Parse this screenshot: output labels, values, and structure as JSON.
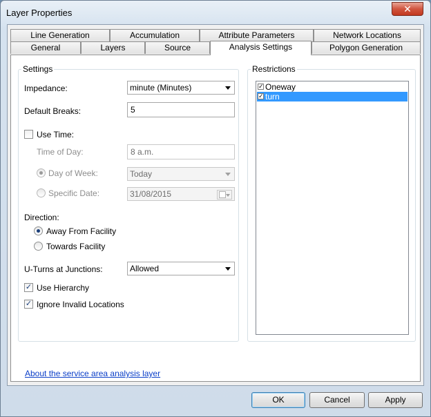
{
  "window": {
    "title": "Layer Properties",
    "close_glyph": "✕"
  },
  "tabs": {
    "row_back": [
      "Line Generation",
      "Accumulation",
      "Attribute Parameters",
      "Network Locations"
    ],
    "row_front": [
      "General",
      "Layers",
      "Source",
      "Analysis Settings",
      "Polygon Generation"
    ],
    "active": "Analysis Settings"
  },
  "settings": {
    "group_label": "Settings",
    "impedance_label": "Impedance:",
    "impedance_value": "minute (Minutes)",
    "default_breaks_label": "Default Breaks:",
    "default_breaks_value": "5",
    "use_time_label": "Use Time:",
    "use_time_checked": false,
    "time_of_day_label": "Time of Day:",
    "time_of_day_value": "8 a.m.",
    "day_of_week_label": "Day of Week:",
    "day_of_week_value": "Today",
    "specific_date_label": "Specific Date:",
    "specific_date_value": "31/08/2015",
    "direction_label": "Direction:",
    "away_label": "Away From Facility",
    "towards_label": "Towards Facility",
    "uturns_label": "U-Turns at Junctions:",
    "uturns_value": "Allowed",
    "use_hierarchy_label": "Use Hierarchy",
    "use_hierarchy_checked": true,
    "ignore_invalid_label": "Ignore Invalid Locations",
    "ignore_invalid_checked": true
  },
  "restrictions": {
    "group_label": "Restrictions",
    "items": [
      {
        "label": "Oneway",
        "checked": true,
        "selected": false
      },
      {
        "label": "turn",
        "checked": true,
        "selected": true
      }
    ]
  },
  "about_link": "About the service area analysis layer",
  "buttons": {
    "ok": "OK",
    "cancel": "Cancel",
    "apply": "Apply"
  },
  "glyphs": {
    "check": "✓"
  },
  "colors": {
    "selection": "#3399ff",
    "link": "#0a3ec8",
    "close_button": "#c2381f"
  }
}
